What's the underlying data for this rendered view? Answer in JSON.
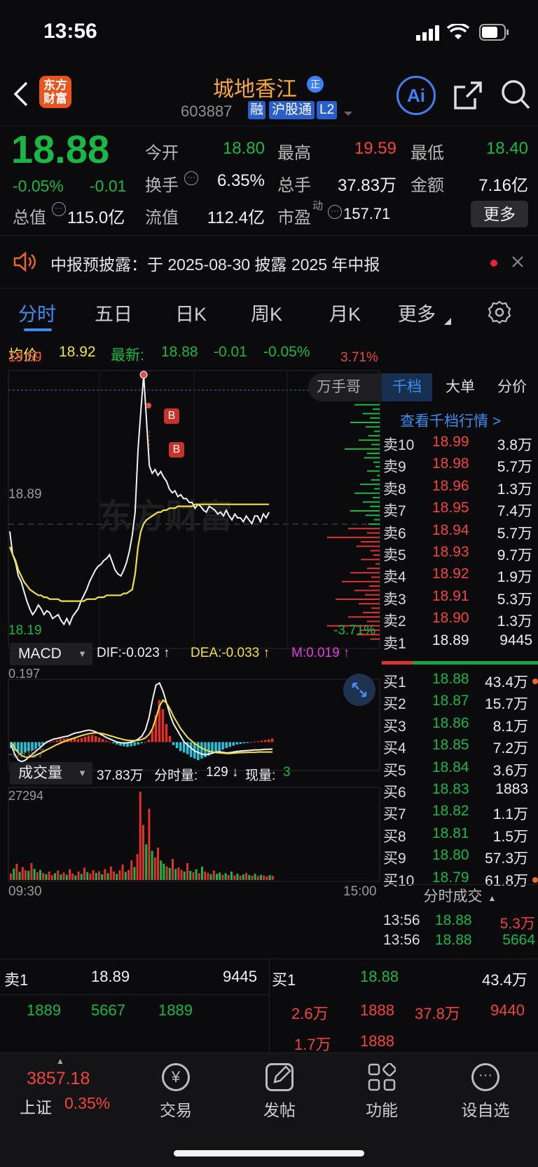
{
  "status_bar": {
    "time": "13:56"
  },
  "header": {
    "logo_text": "东方\n财富",
    "logo_line1": "东方",
    "logo_line2": "财富",
    "stock_name": "城地香江",
    "badge_zheng": "正",
    "code": "603887",
    "tag_rong": "融",
    "tag_hgt": "沪股通",
    "tag_l2": "L2",
    "ai_label": "Ai"
  },
  "quote": {
    "price": "18.88",
    "change_pct": "-0.05%",
    "change": "-0.01",
    "open_label": "今开",
    "open": "18.80",
    "high_label": "最高",
    "high": "19.59",
    "low_label": "最低",
    "low": "18.40",
    "turnover_label": "换手",
    "turnover": "6.35%",
    "volume_label": "总手",
    "volume": "37.83万",
    "amount_label": "金额",
    "amount": "7.16亿",
    "mktcap_label": "总值",
    "mktcap": "115.0亿",
    "float_label": "流值",
    "float_cap": "112.4亿",
    "pe_label": "市盈",
    "pe_sup": "动",
    "pe": "157.71",
    "more_button": "更多"
  },
  "notice": {
    "text": "中报预披露：于 2025-08-30 披露 2025 年中报"
  },
  "tabs": [
    {
      "label": "分时",
      "active": true
    },
    {
      "label": "五日"
    },
    {
      "label": "日K"
    },
    {
      "label": "周K"
    },
    {
      "label": "月K"
    },
    {
      "label": "更多"
    }
  ],
  "chart_info": {
    "avg_label": "均价:",
    "avg": "18.92",
    "latest_label": "最新:",
    "latest": "18.88",
    "latest_change": "-0.01",
    "latest_pct": "-0.05%"
  },
  "chart_data": [
    {
      "type": "line",
      "name": "分时",
      "y_top": "19.59",
      "y_mid": "18.89",
      "y_bottom": "18.19",
      "pct_top": "3.71%",
      "pct_bottom": "-3.71%",
      "ylim": [
        18.19,
        19.59
      ],
      "x_start": "09:30",
      "x_end": "15:00",
      "watermark": "东方财富",
      "overlay_label": "万手哥",
      "marker_b": "B",
      "x": [
        0,
        4,
        8,
        12,
        16,
        20,
        24,
        28,
        32,
        36,
        40,
        44,
        48,
        52,
        56,
        60,
        64,
        68,
        72,
        76,
        80,
        84,
        88,
        92,
        96,
        100,
        104,
        108,
        112,
        116,
        120,
        124,
        128,
        132,
        136,
        140,
        144,
        148,
        152,
        156,
        160,
        164,
        168,
        172,
        176,
        180,
        184,
        188,
        192,
        196,
        200,
        204,
        208,
        212,
        216,
        220,
        224,
        228,
        232,
        236,
        240,
        244,
        248,
        252,
        256,
        260,
        264,
        268,
        272,
        276,
        280,
        284,
        288,
        292,
        296,
        300,
        304,
        308,
        312,
        316,
        320,
        324,
        328,
        332,
        336,
        340,
        344,
        348,
        352,
        356,
        360,
        364
      ],
      "price": [
        18.78,
        18.66,
        18.62,
        18.55,
        18.52,
        18.47,
        18.42,
        18.38,
        18.35,
        18.37,
        18.4,
        18.38,
        18.35,
        18.37,
        18.36,
        18.33,
        18.34,
        18.35,
        18.32,
        18.3,
        18.33,
        18.3,
        18.34,
        18.36,
        18.38,
        18.42,
        18.45,
        18.48,
        18.52,
        18.55,
        18.58,
        18.6,
        18.61,
        18.63,
        18.64,
        18.66,
        18.62,
        18.58,
        18.56,
        18.55,
        18.58,
        18.62,
        18.68,
        18.76,
        18.88,
        19.2,
        19.4,
        19.59,
        19.35,
        19.12,
        19.08,
        19.1,
        19.07,
        19.09,
        19.06,
        19.04,
        19.0,
        18.98,
        18.99,
        18.96,
        18.97,
        18.95,
        18.95,
        18.93,
        18.93,
        18.9,
        18.92,
        18.91,
        18.89,
        18.88,
        18.91,
        18.9,
        18.89,
        18.87,
        18.88,
        18.86,
        18.89,
        18.86,
        18.84,
        18.87,
        18.85,
        18.85,
        18.83,
        18.86,
        18.84,
        18.82,
        18.86,
        18.86,
        18.83,
        18.87,
        18.85,
        18.88
      ],
      "avg": [
        18.7,
        18.66,
        18.63,
        18.58,
        18.55,
        18.52,
        18.5,
        18.48,
        18.47,
        18.46,
        18.45,
        18.45,
        18.44,
        18.44,
        18.43,
        18.43,
        18.43,
        18.43,
        18.42,
        18.42,
        18.42,
        18.42,
        18.42,
        18.42,
        18.42,
        18.42,
        18.42,
        18.43,
        18.43,
        18.43,
        18.43,
        18.44,
        18.44,
        18.44,
        18.45,
        18.45,
        18.45,
        18.45,
        18.45,
        18.45,
        18.46,
        18.46,
        18.47,
        18.48,
        18.56,
        18.7,
        18.78,
        18.82,
        18.84,
        18.85,
        18.86,
        18.87,
        18.88,
        18.88,
        18.89,
        18.89,
        18.9,
        18.9,
        18.9,
        18.91,
        18.91,
        18.91,
        18.91,
        18.91,
        18.91,
        18.92,
        18.92,
        18.92,
        18.92,
        18.92,
        18.92,
        18.92,
        18.92,
        18.92,
        18.92,
        18.92,
        18.92,
        18.92,
        18.92,
        18.92,
        18.92,
        18.92,
        18.92,
        18.92,
        18.92,
        18.92,
        18.92,
        18.92,
        18.92,
        18.92,
        18.92,
        18.92
      ]
    },
    {
      "type": "bar",
      "name": "MACD",
      "dif": "DIF:-0.023 ↑",
      "dea": "DEA:-0.033 ↑",
      "m": "M:0.019 ↑",
      "y_top": "0.197",
      "y_bottom": "-0.087",
      "ylim": [
        -0.09,
        0.2
      ],
      "hist": [
        -0.02,
        -0.03,
        -0.035,
        -0.04,
        -0.035,
        -0.03,
        -0.028,
        -0.022,
        -0.015,
        -0.008,
        -0.004,
        0.0,
        0.003,
        0.006,
        0.01,
        0.012,
        0.013,
        0.013,
        0.012,
        0.01,
        0.014,
        0.018,
        0.022,
        0.024,
        0.02,
        0.015,
        0.01,
        0.005,
        0.0,
        -0.004,
        -0.008,
        -0.012,
        -0.014,
        -0.016,
        -0.014,
        -0.012,
        -0.008,
        -0.004,
        0.0,
        0.008,
        0.04,
        0.09,
        0.14,
        0.11,
        0.06,
        0.02,
        -0.01,
        -0.02,
        -0.03,
        -0.035,
        -0.04,
        -0.05,
        -0.055,
        -0.06,
        -0.055,
        -0.05,
        -0.045,
        -0.04,
        -0.035,
        -0.03,
        -0.025,
        -0.02,
        -0.016,
        -0.012,
        -0.008,
        -0.006,
        -0.004,
        -0.003,
        0.0,
        0.002,
        0.003,
        0.005,
        0.007,
        0.009,
        0.012
      ],
      "dif_line": [
        -0.01,
        -0.04,
        -0.06,
        -0.065,
        -0.06,
        -0.05,
        -0.04,
        -0.03,
        -0.02,
        -0.01,
        0.0,
        0.005,
        0.01,
        0.012,
        0.015,
        0.018,
        0.02,
        0.025,
        0.03,
        0.032,
        0.035,
        0.038,
        0.04,
        0.038,
        0.034,
        0.028,
        0.022,
        0.015,
        0.01,
        0.005,
        0.0,
        -0.002,
        -0.003,
        -0.002,
        0.0,
        0.004,
        0.01,
        0.02,
        0.04,
        0.08,
        0.14,
        0.19,
        0.197,
        0.17,
        0.13,
        0.09,
        0.06,
        0.04,
        0.02,
        0.0,
        -0.01,
        -0.02,
        -0.03,
        -0.035,
        -0.04,
        -0.042,
        -0.04,
        -0.036,
        -0.033,
        -0.032,
        -0.034,
        -0.036,
        -0.035,
        -0.033,
        -0.031,
        -0.03,
        -0.029,
        -0.028,
        -0.027,
        -0.026,
        -0.026,
        -0.025,
        -0.024,
        -0.024,
        -0.023
      ],
      "dea_line": [
        0.0,
        -0.02,
        -0.035,
        -0.045,
        -0.05,
        -0.05,
        -0.048,
        -0.044,
        -0.038,
        -0.032,
        -0.026,
        -0.02,
        -0.014,
        -0.008,
        -0.003,
        0.002,
        0.006,
        0.01,
        0.014,
        0.018,
        0.022,
        0.025,
        0.028,
        0.03,
        0.031,
        0.03,
        0.028,
        0.025,
        0.021,
        0.018,
        0.014,
        0.011,
        0.008,
        0.006,
        0.005,
        0.005,
        0.006,
        0.009,
        0.014,
        0.025,
        0.045,
        0.08,
        0.12,
        0.14,
        0.13,
        0.11,
        0.085,
        0.065,
        0.045,
        0.03,
        0.015,
        0.005,
        -0.005,
        -0.013,
        -0.02,
        -0.026,
        -0.03,
        -0.033,
        -0.035,
        -0.036,
        -0.037,
        -0.038,
        -0.038,
        -0.037,
        -0.036,
        -0.035,
        -0.035,
        -0.034,
        -0.034,
        -0.034,
        -0.033,
        -0.033,
        -0.033,
        -0.033,
        -0.033
      ]
    },
    {
      "type": "bar",
      "name": "成交量",
      "total": "37.83万",
      "minute_vol_label": "分时量:",
      "minute_vol": "129 ↓",
      "cur_vol_label": "现量:",
      "cur_vol": "3",
      "y_top": "27294",
      "ylim": [
        0,
        27294
      ],
      "values": [
        2000,
        3500,
        5000,
        2500,
        4000,
        3000,
        2800,
        5200,
        3500,
        2400,
        3100,
        2200,
        1800,
        2600,
        1500,
        2100,
        2900,
        1700,
        2300,
        1600,
        3300,
        2000,
        1400,
        2600,
        1900,
        3800,
        2400,
        2000,
        3000,
        2200,
        2700,
        1800,
        3400,
        2100,
        4200,
        2600,
        1900,
        3000,
        4800,
        2500,
        3100,
        6100,
        4000,
        8000,
        27294,
        17000,
        11000,
        22000,
        9000,
        7000,
        10000,
        6000,
        5000,
        4200,
        3700,
        6500,
        3400,
        3900,
        3100,
        2600,
        5200,
        2800,
        2400,
        3300,
        2100,
        4100,
        2600,
        2200,
        1800,
        2900,
        1900,
        2300,
        1600,
        2100,
        1500,
        2600,
        1400,
        1900,
        1300,
        1700,
        2200,
        1500,
        1300,
        1900,
        1200,
        1600,
        1400,
        1100,
        1500,
        1300
      ],
      "up": [
        1,
        0,
        1,
        0,
        1,
        1,
        0,
        1,
        0,
        1,
        0,
        1,
        0,
        1,
        1,
        0,
        1,
        0,
        1,
        0,
        1,
        1,
        0,
        1,
        0,
        1,
        0,
        1,
        1,
        0,
        1,
        0,
        1,
        0,
        1,
        1,
        0,
        1,
        1,
        0,
        1,
        1,
        0,
        1,
        1,
        1,
        0,
        1,
        0,
        1,
        1,
        0,
        0,
        1,
        0,
        1,
        0,
        1,
        1,
        0,
        1,
        0,
        1,
        0,
        1,
        0,
        1,
        1,
        0,
        1,
        0,
        0,
        1,
        0,
        1,
        0,
        1,
        0,
        1,
        0,
        1,
        0,
        1,
        0,
        1,
        0,
        1,
        1,
        0,
        1
      ]
    }
  ],
  "order_book": {
    "tabs": [
      "千档",
      "大单",
      "分价"
    ],
    "view_link": "查看千档行情 >",
    "asks": [
      {
        "label": "卖10",
        "price": "18.99",
        "vol": "3.8万"
      },
      {
        "label": "卖9",
        "price": "18.98",
        "vol": "5.7万"
      },
      {
        "label": "卖8",
        "price": "18.96",
        "vol": "1.3万"
      },
      {
        "label": "卖7",
        "price": "18.95",
        "vol": "7.4万"
      },
      {
        "label": "卖6",
        "price": "18.94",
        "vol": "5.7万"
      },
      {
        "label": "卖5",
        "price": "18.93",
        "vol": "9.7万"
      },
      {
        "label": "卖4",
        "price": "18.92",
        "vol": "1.9万"
      },
      {
        "label": "卖3",
        "price": "18.91",
        "vol": "5.3万"
      },
      {
        "label": "卖2",
        "price": "18.90",
        "vol": "1.3万"
      },
      {
        "label": "卖1",
        "price": "18.89",
        "vol": "9445"
      }
    ],
    "bids": [
      {
        "label": "买1",
        "price": "18.88",
        "vol": "43.4万"
      },
      {
        "label": "买2",
        "price": "18.87",
        "vol": "15.7万"
      },
      {
        "label": "买3",
        "price": "18.86",
        "vol": "8.1万"
      },
      {
        "label": "买4",
        "price": "18.85",
        "vol": "7.2万"
      },
      {
        "label": "买5",
        "price": "18.84",
        "vol": "3.6万"
      },
      {
        "label": "买6",
        "price": "18.83",
        "vol": "1883"
      },
      {
        "label": "买7",
        "price": "18.82",
        "vol": "1.1万"
      },
      {
        "label": "买8",
        "price": "18.81",
        "vol": "1.5万"
      },
      {
        "label": "买9",
        "price": "18.80",
        "vol": "57.3万"
      },
      {
        "label": "买10",
        "price": "18.79",
        "vol": "61.8万"
      }
    ],
    "trades_label": "分时成交",
    "trades": [
      {
        "time": "13:56",
        "price": "18.88",
        "vol": "5.3万"
      },
      {
        "time": "13:56",
        "price": "18.88",
        "vol": "5664"
      }
    ]
  },
  "bottom_rows": {
    "sell1_label": "卖1",
    "sell1_price": "18.89",
    "sell1_vol": "9445",
    "buy1_label": "买1",
    "buy1_price": "18.88",
    "buy1_vol": "43.4万",
    "sell_queue": [
      "1889",
      "5667",
      "1889"
    ],
    "buy_queue_row1": [
      "2.6万",
      "1888",
      "37.8万",
      "9440"
    ],
    "buy_queue_row2": [
      "1.7万",
      "1888"
    ]
  },
  "nav": {
    "index_value": "3857.18",
    "index_name": "上证",
    "index_pct": "0.35%",
    "items": [
      "交易",
      "发帖",
      "功能",
      "设自选"
    ]
  }
}
